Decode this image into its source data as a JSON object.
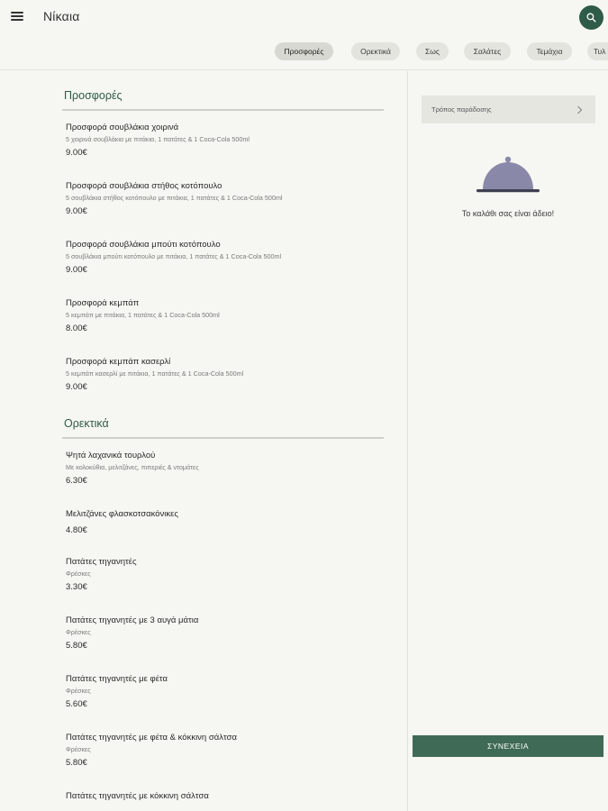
{
  "header": {
    "title": "Νίκαια",
    "menu_icon": "hamburger-menu-icon",
    "search_icon": "search-icon",
    "accent_color": "#2f5c48"
  },
  "tabs": [
    {
      "label": "Προσφορές",
      "active": true
    },
    {
      "label": "Ορεκτικά",
      "active": false
    },
    {
      "label": "Σως",
      "active": false
    },
    {
      "label": "Σαλάτες",
      "active": false
    },
    {
      "label": "Τεμάχια",
      "active": false
    },
    {
      "label": "Τυλ",
      "active": false
    }
  ],
  "sections": [
    {
      "title": "Προσφορές",
      "items": [
        {
          "name": "Προσφορά σουβλάκια χοιρινά",
          "desc": "5 χοιρινά σουβλάκια με πιτάκια, 1 πατάτες & 1 Coca-Cola 500ml",
          "price": "9.00€"
        },
        {
          "name": "Προσφορά σουβλάκια στήθος κοτόπουλο",
          "desc": "5 σουβλάκια στήθος κοτόπουλο με πιτάκια, 1 πατάτες & 1 Coca-Cola 500ml",
          "price": "9.00€"
        },
        {
          "name": "Προσφορά σουβλάκια μπούτι κοτόπουλο",
          "desc": "5 σουβλάκια μπούτι κοτόπουλο με πιτάκια, 1 πατάτες & 1 Coca-Cola 500ml",
          "price": "9.00€"
        },
        {
          "name": "Προσφορά κεμπάπ",
          "desc": "5 κεμπάπ με πιτάκια, 1 πατάτες & 1 Coca-Cola 500ml",
          "price": "8.00€"
        },
        {
          "name": "Προσφορά κεμπάπ κασερλί",
          "desc": "5 κεμπάπ κασερλί με πιτάκια, 1 πατάτες & 1 Coca-Cola 500ml",
          "price": "9.00€"
        }
      ]
    },
    {
      "title": "Ορεκτικά",
      "items": [
        {
          "name": "Ψητά λαχανικά τουρλού",
          "desc": "Με κολοκύθια, μελιτζάνες, πιπεριές & ντομάτες",
          "price": "6.30€"
        },
        {
          "name": "Μελιτζάνες φλασκοτσακόνικες",
          "desc": "",
          "price": "4.80€"
        },
        {
          "name": "Πατάτες τηγανητές",
          "desc": "Φρέσκες",
          "price": "3.30€"
        },
        {
          "name": "Πατάτες τηγανητές με 3 αυγά μάτια",
          "desc": "Φρέσκες",
          "price": "5.80€"
        },
        {
          "name": "Πατάτες τηγανητές με φέτα",
          "desc": "Φρέσκες",
          "price": "5.60€"
        },
        {
          "name": "Πατάτες τηγανητές με φέτα & κόκκινη σάλτσα",
          "desc": "Φρέσκες",
          "price": "5.80€"
        },
        {
          "name": "Πατάτες τηγανητές με κόκκινη σάλτσα",
          "desc": "",
          "price": ""
        }
      ]
    }
  ],
  "cart": {
    "delivery_label": "Τρόπος παράδοσης",
    "empty_icon": "cloche-icon",
    "empty_text": "Το καλάθι σας είναι άδειο!",
    "continue_label": "ΣΥΝΕΧΕΙΑ",
    "button_color": "#3f6a55",
    "cloche_color": "#8a88a8"
  }
}
